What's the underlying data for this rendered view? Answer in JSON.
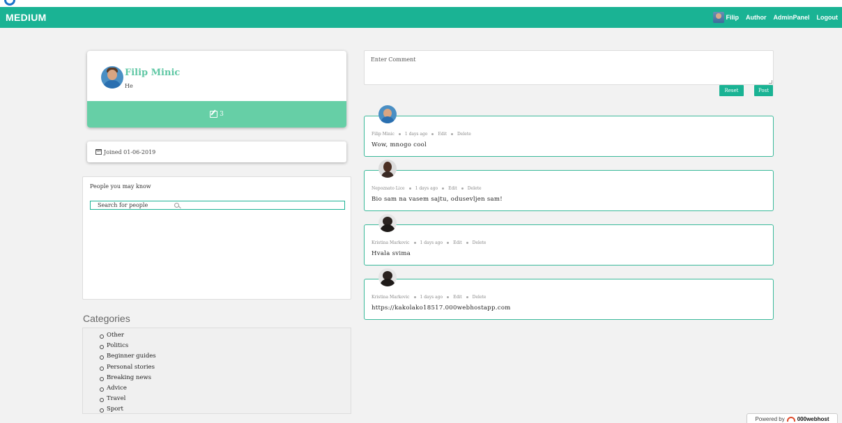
{
  "navbar": {
    "brand": "MEDIUM",
    "user_name": "Filip",
    "links": [
      "Author",
      "AdminPanel",
      "Logout"
    ]
  },
  "profile": {
    "name": "Filip Minic",
    "bio": "He",
    "post_count": "3",
    "joined": "Joined 01-06-2019"
  },
  "people": {
    "title": "People you may know",
    "search_value": "Search for people"
  },
  "categories": {
    "title": "Categories",
    "items": [
      "Other",
      "Politics",
      "Beginner guides",
      "Personal stories",
      "Breaking news",
      "Advice",
      "Travel",
      "Sport"
    ]
  },
  "comment_form": {
    "placeholder": "Enter Comment",
    "reset_label": "Reset",
    "post_label": "Post"
  },
  "comments": [
    {
      "author": "Filip Minic",
      "time": "1 days ago",
      "edit": "Edit",
      "delete": "Delete",
      "text": "Wow, mnogo cool"
    },
    {
      "author": "Nepoznato Lice",
      "time": "1 days ago",
      "edit": "Edit",
      "delete": "Delete",
      "text": "Bio sam na vasem sajtu, odusevljen sam!"
    },
    {
      "author": "Kristina Markovic",
      "time": "1 days ago",
      "edit": "Edit",
      "delete": "Delete",
      "text": "Hvala svima"
    },
    {
      "author": "Kristina Markovic",
      "time": "1 days ago",
      "edit": "Edit",
      "delete": "Delete",
      "text": "https://kakolako18517.000webhostapp.com"
    }
  ],
  "footer": {
    "powered_prefix": "Powered by",
    "powered_brand": "000webhost"
  },
  "colors": {
    "primary": "#1ab394",
    "profile_bar": "#66cfa6",
    "name": "#5fc7a4"
  }
}
